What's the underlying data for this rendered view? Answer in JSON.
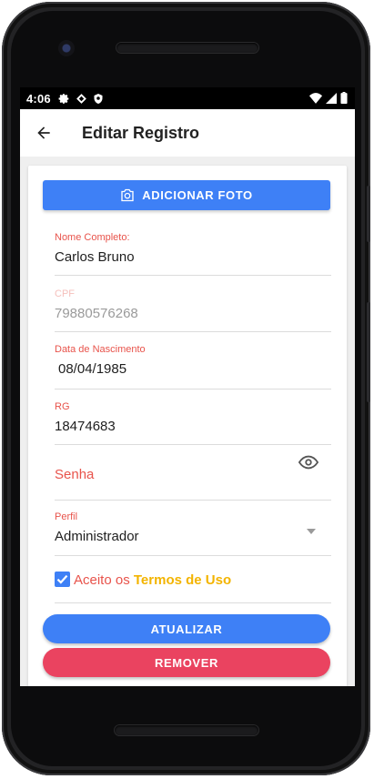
{
  "status": {
    "time": "4:06"
  },
  "appbar": {
    "title": "Editar Registro"
  },
  "form": {
    "photo_button": "ADICIONAR FOTO",
    "nome": {
      "label": "Nome Completo:",
      "value": "Carlos Bruno"
    },
    "cpf": {
      "label": "CPF",
      "value": "79880576268"
    },
    "nascimento": {
      "label": "Data de Nascimento",
      "value": "08/04/1985"
    },
    "rg": {
      "label": "RG",
      "value": "18474683"
    },
    "senha": {
      "placeholder": "Senha"
    },
    "perfil": {
      "label": "Perfil",
      "value": "Administrador"
    },
    "terms": {
      "prefix": "Aceito os",
      "link": "Termos de Uso",
      "checked": true
    },
    "update_button": "ATUALIZAR",
    "remove_button": "REMOVER"
  },
  "colors": {
    "primary": "#3e80f6",
    "danger": "#ea4360",
    "label": "#e8534b",
    "link": "#f3b400"
  }
}
